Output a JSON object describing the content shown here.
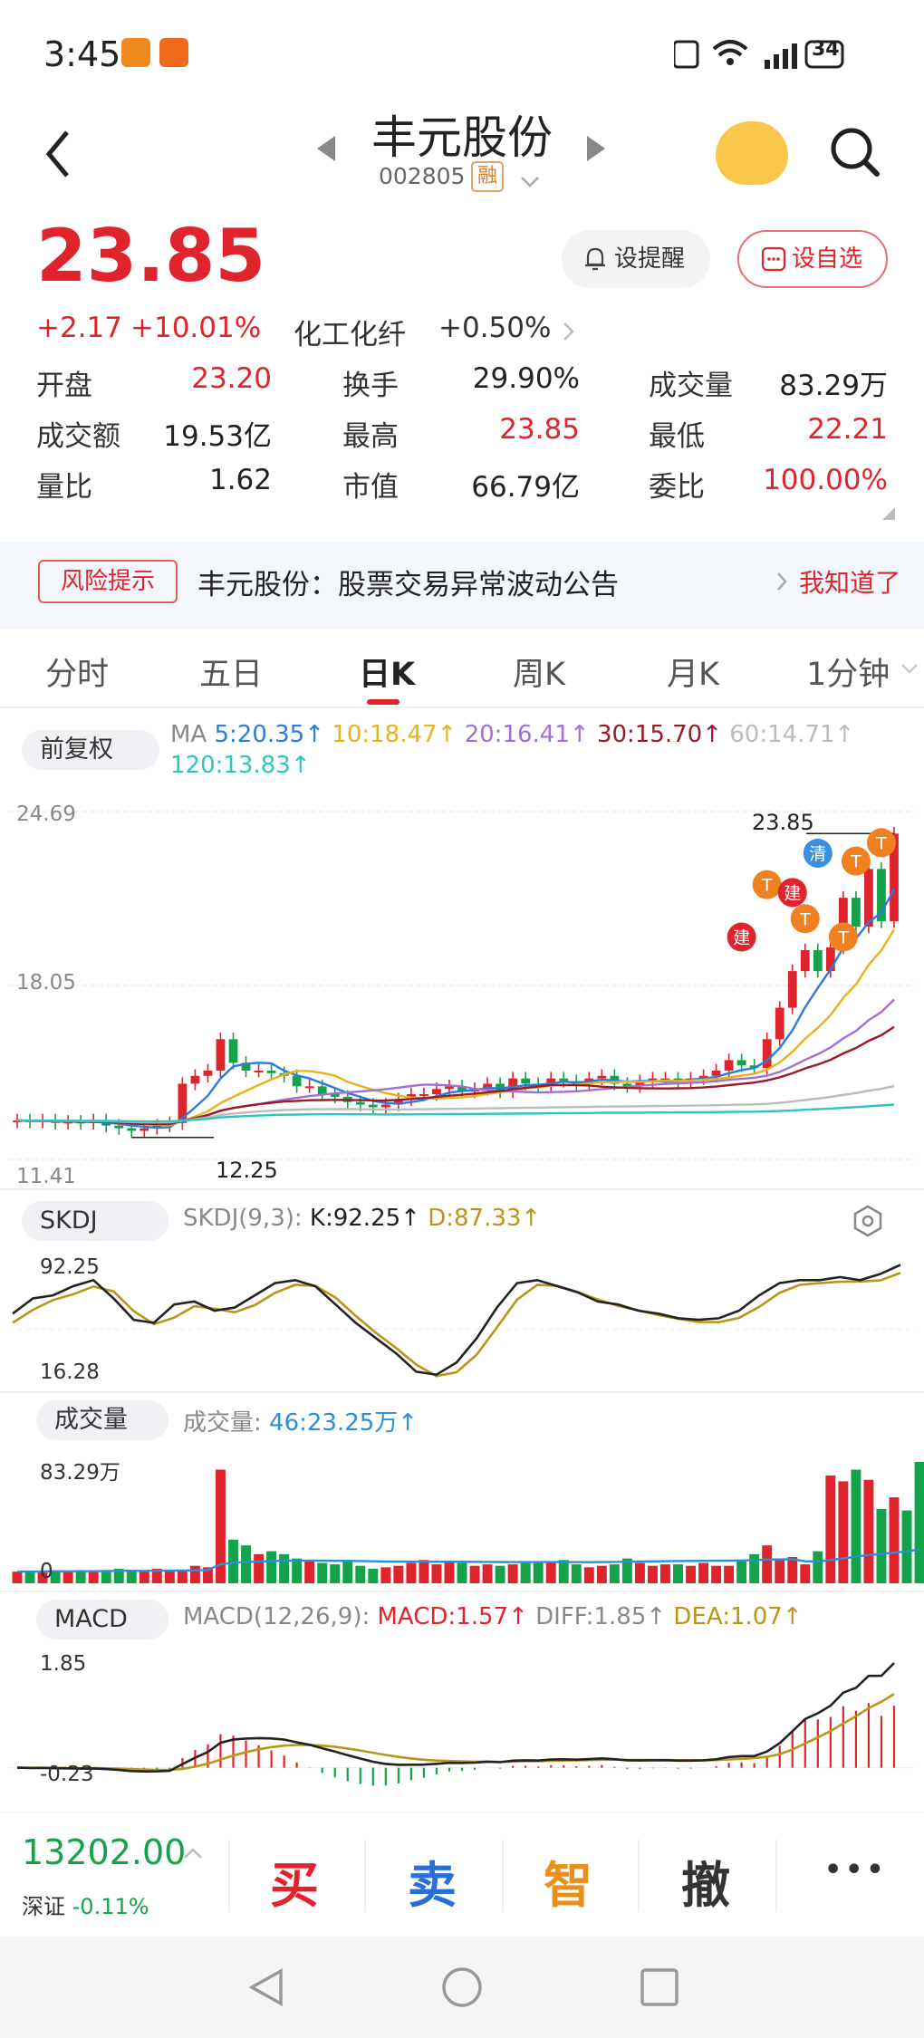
{
  "status_bar": {
    "time": "3:45",
    "battery": "34"
  },
  "header": {
    "title": "丰元股份",
    "code": "002805",
    "margin_badge": "融"
  },
  "quote": {
    "price": "23.85",
    "change": "+2.17",
    "change_pct": "+10.01%",
    "sector": "化工化纤",
    "sector_pct": "+0.50%",
    "alert_label": "设提醒",
    "fav_label": "设自选"
  },
  "stats": [
    [
      {
        "label": "开盘",
        "value": "23.20",
        "color": "red"
      },
      {
        "label": "换手",
        "value": "29.90%",
        "color": "black"
      },
      {
        "label": "成交量",
        "value": "83.29万",
        "color": "black"
      }
    ],
    [
      {
        "label": "成交额",
        "value": "19.53亿",
        "color": "black"
      },
      {
        "label": "最高",
        "value": "23.85",
        "color": "red"
      },
      {
        "label": "最低",
        "value": "22.21",
        "color": "red"
      }
    ],
    [
      {
        "label": "量比",
        "value": "1.62",
        "color": "black"
      },
      {
        "label": "市值",
        "value": "66.79亿",
        "color": "black"
      },
      {
        "label": "委比",
        "value": "100.00%",
        "color": "red"
      }
    ]
  ],
  "notice": {
    "tag": "风险提示",
    "text": "丰元股份：股票交易异常波动公告",
    "action": "我知道了"
  },
  "tabs": [
    "分时",
    "五日",
    "日K",
    "周K",
    "月K",
    "1分钟"
  ],
  "active_tab": 2,
  "kline": {
    "adjust": "前复权",
    "ma_prefix": "MA",
    "ma": [
      {
        "label": "5:20.35↑",
        "color": "#2a7be0"
      },
      {
        "label": "10:18.47↑",
        "color": "#e8b21a"
      },
      {
        "label": "20:16.41↑",
        "color": "#a070d8"
      },
      {
        "label": "30:15.70↑",
        "color": "#9b1a26"
      },
      {
        "label": "60:14.71↑",
        "color": "#bbbbbb"
      },
      {
        "label": "120:13.83↑",
        "color": "#2cc5bf"
      }
    ],
    "y_top": "24.69",
    "y_mid": "18.05",
    "y_bot": "11.41",
    "high_label": "23.85",
    "low_label": "12.25",
    "markers": {
      "t": "T",
      "jian": "建",
      "qing": "清"
    }
  },
  "skdj": {
    "name": "SKDJ",
    "params": "SKDJ(9,3):",
    "k": "K:92.25↑",
    "d": "D:87.33↑",
    "y_top": "92.25",
    "y_bot": "16.28"
  },
  "volume": {
    "name": "成交量",
    "prefix": "成交量:",
    "ma": "46:23.25万↑",
    "y_top": "83.29万",
    "y_bot": "0"
  },
  "macd": {
    "name": "MACD",
    "params": "MACD(12,26,9):",
    "macd": "MACD:1.57↑",
    "diff": "DIFF:1.85↑",
    "dea": "DEA:1.07↑",
    "y_top": "1.85",
    "y_bot": "-0.23"
  },
  "index": {
    "value": "13202.00",
    "name": "深证",
    "pct": "-0.11%"
  },
  "actions": [
    {
      "label": "买",
      "color": "#e0242e"
    },
    {
      "label": "卖",
      "color": "#2a6fd6"
    },
    {
      "label": "智",
      "color": "#e8901a"
    },
    {
      "label": "撤",
      "color": "#333333"
    }
  ],
  "more": "•••",
  "chart_data": {
    "type": "candlestick",
    "y_range": [
      11.41,
      24.69
    ],
    "close_approx": [
      12.9,
      12.85,
      12.9,
      12.8,
      12.85,
      12.8,
      12.9,
      12.7,
      12.6,
      12.5,
      12.6,
      12.7,
      12.8,
      14.3,
      14.6,
      14.8,
      16.0,
      15.1,
      14.8,
      14.8,
      14.7,
      14.6,
      14.2,
      14.2,
      13.9,
      13.8,
      13.6,
      13.5,
      13.4,
      13.5,
      13.7,
      13.9,
      13.9,
      14.1,
      14.2,
      14.0,
      14.1,
      14.3,
      14.0,
      14.5,
      14.3,
      14.2,
      14.5,
      14.4,
      14.3,
      14.5,
      14.6,
      14.3,
      14.2,
      14.4,
      14.5,
      14.5,
      14.4,
      14.5,
      14.6,
      14.8,
      15.2,
      15.0,
      14.9,
      16.0,
      17.2,
      18.6,
      19.4,
      18.6,
      19.5,
      21.4,
      20.3,
      22.5,
      20.5,
      23.85
    ],
    "volume_approx": [
      8,
      8,
      8,
      9,
      8,
      9,
      8,
      9,
      10,
      9,
      8,
      10,
      9,
      9,
      12,
      11,
      78,
      30,
      26,
      20,
      22,
      20,
      17,
      16,
      14,
      13,
      15,
      12,
      10,
      11,
      12,
      14,
      16,
      13,
      15,
      14,
      12,
      13,
      12,
      13,
      14,
      14,
      15,
      16,
      13,
      11,
      12,
      13,
      17,
      14,
      12,
      13,
      13,
      12,
      14,
      12,
      12,
      15,
      20,
      26,
      17,
      18,
      13,
      22,
      74,
      70,
      78,
      71,
      51,
      59,
      50,
      83.29
    ],
    "skdj": {
      "k_last": 92.25,
      "d_last": 87.33,
      "y_range": [
        16.28,
        92.25
      ]
    },
    "volume": {
      "y_range": [
        0,
        83.29
      ],
      "unit": "万",
      "ma46_last": 23.25
    },
    "macd": {
      "diff_last": 1.85,
      "dea_last": 1.07,
      "macd_last": 1.57,
      "y_range": [
        -0.23,
        1.85
      ]
    }
  }
}
